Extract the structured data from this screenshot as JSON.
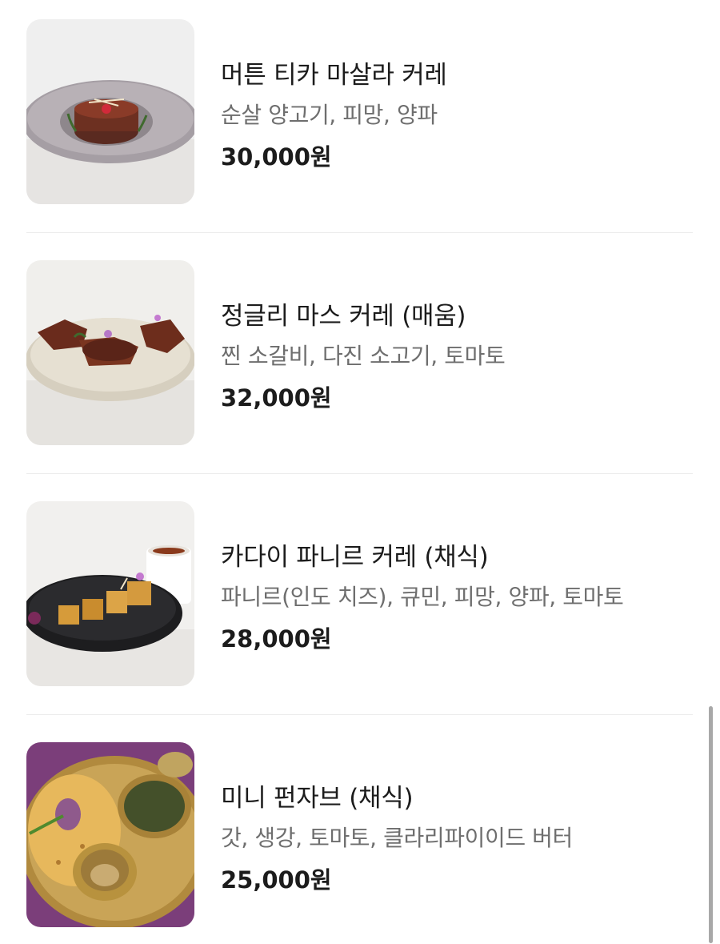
{
  "menu": {
    "items": [
      {
        "name": "머튼 티카 마살라 커레",
        "description": "순살 양고기, 피망, 양파",
        "price": "30,000원"
      },
      {
        "name": "정글리 마스 커레 (매움)",
        "description": "찐 소갈비, 다진 소고기, 토마토",
        "price": "32,000원"
      },
      {
        "name": "카다이 파니르 커레 (채식)",
        "description": "파니르(인도 치즈), 큐민, 피망, 양파, 토마토",
        "price": "28,000원"
      },
      {
        "name": "미니 펀자브 (채식)",
        "description": "갓, 생강, 토마토, 클라리파이이드 버터",
        "price": "25,000원"
      }
    ]
  }
}
